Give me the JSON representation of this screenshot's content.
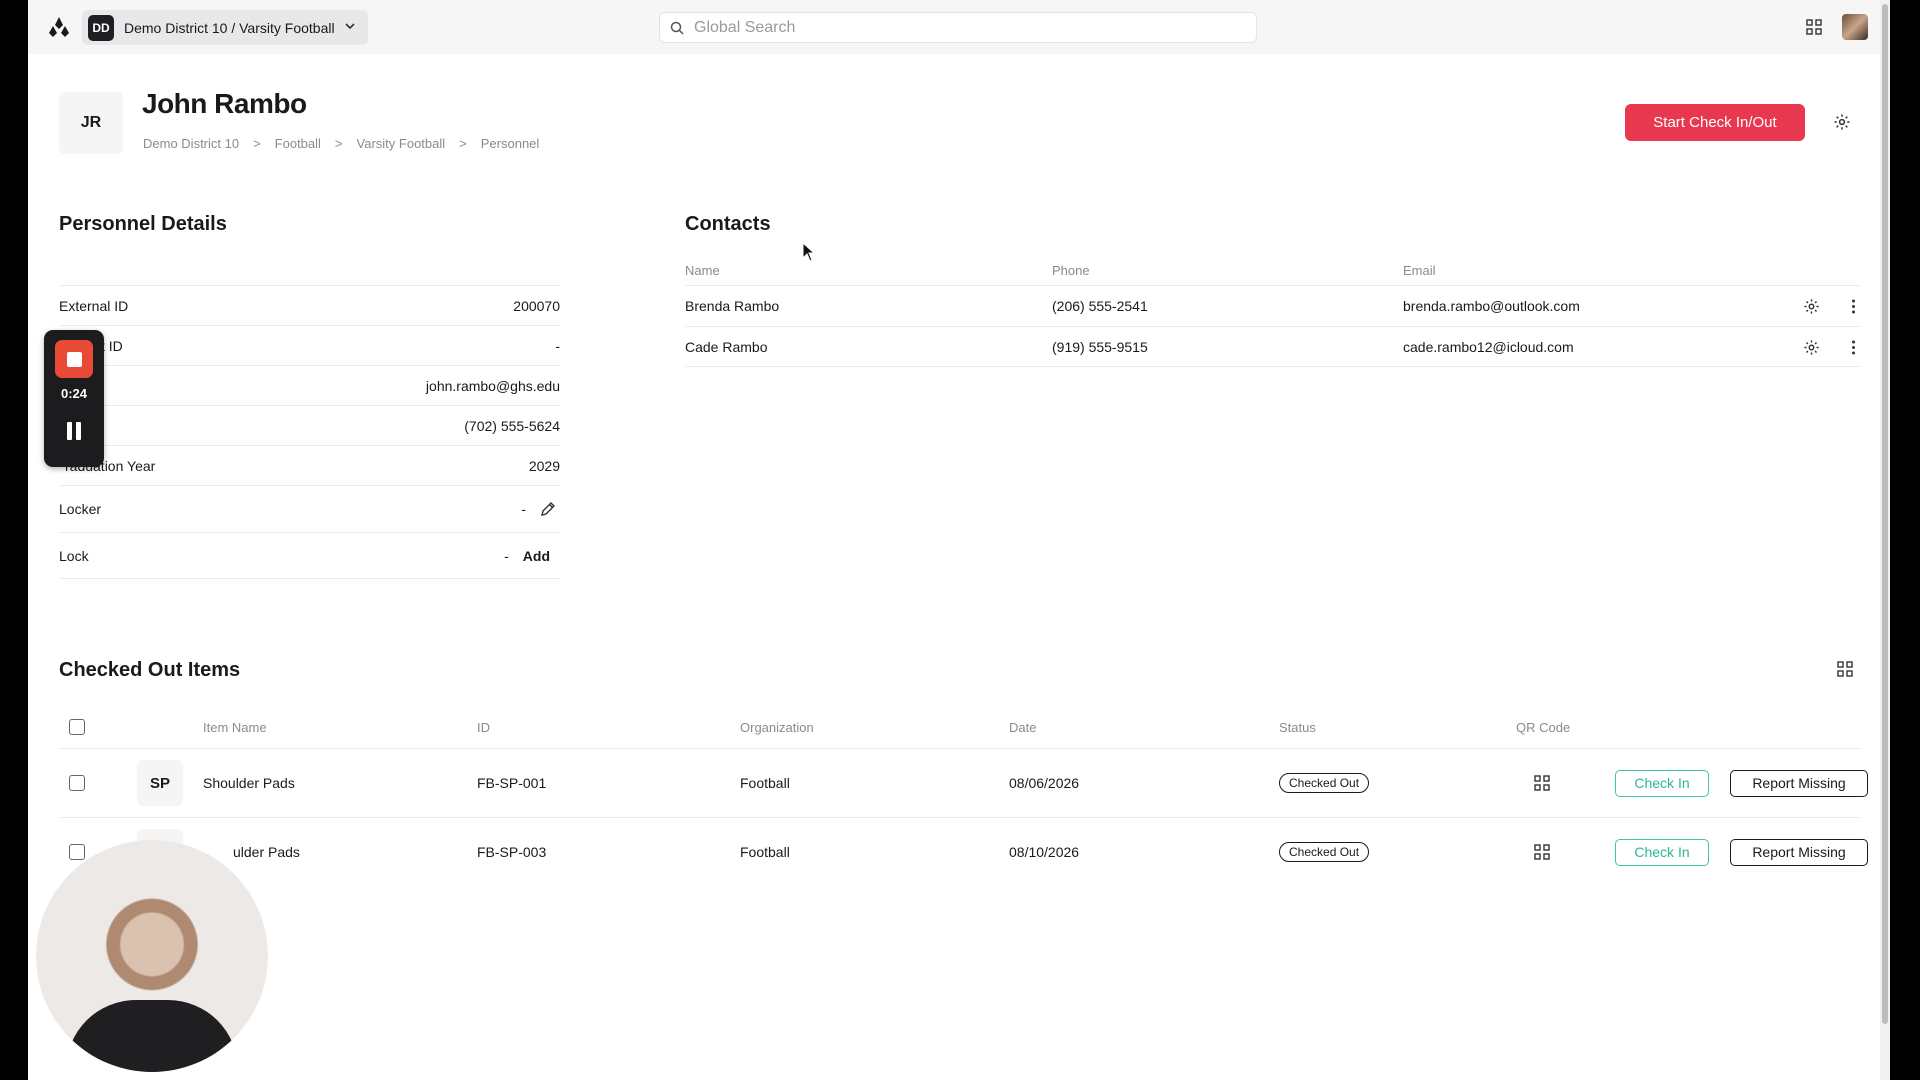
{
  "topbar": {
    "org_badge": "DD",
    "org_name": "Demo District 10 / Varsity Football",
    "search_placeholder": "Global Search"
  },
  "header": {
    "initials": "JR",
    "name": "John Rambo",
    "breadcrumb": [
      "Demo District 10",
      "Football",
      "Varsity Football",
      "Personnel"
    ],
    "breadcrumb_sep": ">",
    "primary_button": "Start Check In/Out",
    "accent_color": "#e8384f"
  },
  "details": {
    "title": "Personnel Details",
    "rows": [
      {
        "label": "External ID",
        "value": "200070"
      },
      {
        "label": "t ID",
        "value": "-"
      },
      {
        "label": "",
        "value": "john.rambo@ghs.edu"
      },
      {
        "label": "",
        "value": "(702) 555-5624"
      },
      {
        "label": "raduation Year",
        "value": "2029"
      },
      {
        "label": "Locker",
        "value": "-"
      },
      {
        "label": "Lock",
        "value": "-",
        "action": "Add"
      }
    ]
  },
  "contacts": {
    "title": "Contacts",
    "columns": [
      "Name",
      "Phone",
      "Email"
    ],
    "rows": [
      {
        "name": "Brenda Rambo",
        "phone": "(206) 555-2541",
        "email": "brenda.rambo@outlook.com"
      },
      {
        "name": "Cade Rambo",
        "phone": "(919) 555-9515",
        "email": "cade.rambo12@icloud.com"
      }
    ]
  },
  "items": {
    "title": "Checked Out Items",
    "columns": [
      "Item Name",
      "ID",
      "Organization",
      "Date",
      "Status",
      "QR Code"
    ],
    "rows": [
      {
        "thumb": "SP",
        "name": "Shoulder Pads",
        "id": "FB-SP-001",
        "org": "Football",
        "date": "08/06/2026",
        "status": "Checked Out",
        "checkin": "Check In",
        "missing": "Report Missing"
      },
      {
        "thumb": "",
        "name": "ulder Pads",
        "id": "FB-SP-003",
        "org": "Football",
        "date": "08/10/2026",
        "status": "Checked Out",
        "checkin": "Check In",
        "missing": "Report Missing"
      }
    ],
    "checkin_color": "#3cc6a8"
  },
  "recorder": {
    "time": "0:24",
    "stop_color": "#e84a36"
  }
}
